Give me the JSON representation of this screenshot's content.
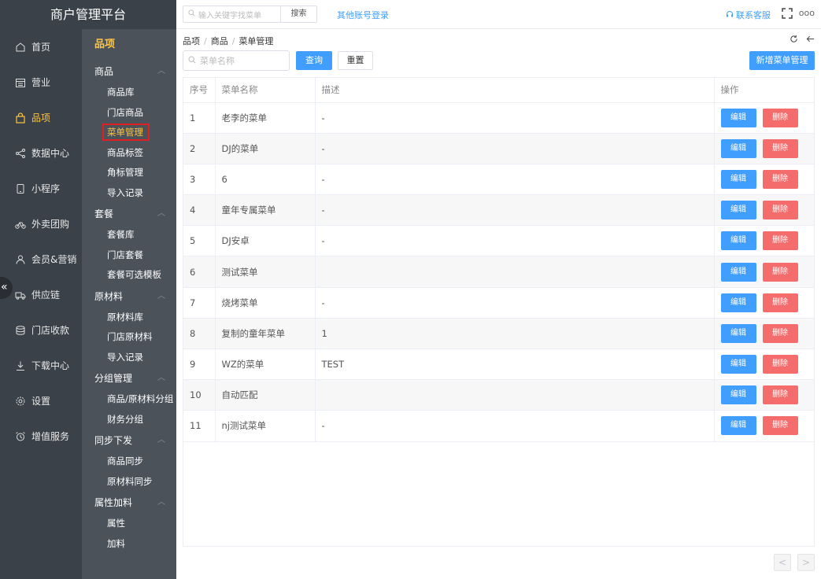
{
  "app": {
    "title": "商户管理平台"
  },
  "topbar": {
    "search_placeholder": "输入关键字找菜单",
    "search_button": "搜索",
    "other_login": "其他账号登录",
    "contact": "联系客服",
    "more": "ooo"
  },
  "nav": {
    "items": [
      {
        "label": "首页",
        "icon": "home-icon",
        "active": false
      },
      {
        "label": "营业",
        "icon": "calendar-icon",
        "active": false
      },
      {
        "label": "品项",
        "icon": "bag-icon",
        "active": true
      },
      {
        "label": "数据中心",
        "icon": "share-icon",
        "active": false
      },
      {
        "label": "小程序",
        "icon": "phone-icon",
        "active": false
      },
      {
        "label": "外卖团购",
        "icon": "bike-icon",
        "active": false
      },
      {
        "label": "会员&营销",
        "icon": "user-icon",
        "active": false
      },
      {
        "label": "供应链",
        "icon": "truck-icon",
        "active": false
      },
      {
        "label": "门店收款",
        "icon": "database-icon",
        "active": false
      },
      {
        "label": "下载中心",
        "icon": "download-icon",
        "active": false
      },
      {
        "label": "设置",
        "icon": "gear-icon",
        "active": false
      },
      {
        "label": "增值服务",
        "icon": "alarm-icon",
        "active": false
      }
    ],
    "collapse": "«"
  },
  "subnav": {
    "title": "品项",
    "groups": [
      {
        "label": "商品",
        "items": [
          "商品库",
          "门店商品",
          "菜单管理",
          "商品标签",
          "角标管理",
          "导入记录"
        ]
      },
      {
        "label": "套餐",
        "items": [
          "套餐库",
          "门店套餐",
          "套餐可选模板"
        ]
      },
      {
        "label": "原材料",
        "items": [
          "原材料库",
          "门店原材料",
          "导入记录"
        ]
      },
      {
        "label": "分组管理",
        "items": [
          "商品/原材料分组",
          "财务分组"
        ]
      },
      {
        "label": "同步下发",
        "items": [
          "商品同步",
          "原材料同步"
        ]
      },
      {
        "label": "属性加料",
        "items": [
          "属性",
          "加料"
        ]
      }
    ]
  },
  "breadcrumb": {
    "a": "品项",
    "b": "商品",
    "c": "菜单管理",
    "sep": "/"
  },
  "filters": {
    "name_placeholder": "菜单名称",
    "query": "查询",
    "reset": "重置",
    "new": "新增菜单管理"
  },
  "table": {
    "headers": [
      "序号",
      "菜单名称",
      "描述",
      "操作"
    ],
    "edit": "编辑",
    "delete": "删除",
    "rows": [
      {
        "no": "1",
        "name": "老李的菜单",
        "desc": "-"
      },
      {
        "no": "2",
        "name": "DJ的菜单",
        "desc": "-"
      },
      {
        "no": "3",
        "name": "6",
        "desc": "-"
      },
      {
        "no": "4",
        "name": "童年专属菜单",
        "desc": "-"
      },
      {
        "no": "5",
        "name": "DJ安卓",
        "desc": "-"
      },
      {
        "no": "6",
        "name": "测试菜单",
        "desc": ""
      },
      {
        "no": "7",
        "name": "烧烤菜单",
        "desc": "-"
      },
      {
        "no": "8",
        "name": "复制的童年菜单",
        "desc": "1"
      },
      {
        "no": "9",
        "name": "WZ的菜单",
        "desc": "TEST"
      },
      {
        "no": "10",
        "name": "自动匹配",
        "desc": ""
      },
      {
        "no": "11",
        "name": "nj测试菜单",
        "desc": "-"
      }
    ]
  },
  "pager": {
    "prev": "<",
    "next": ">"
  },
  "colors": {
    "primary": "#409eff",
    "danger": "#f56c6c",
    "accent": "#ffc53d",
    "nav_bg": "#3b4148",
    "subnav_bg": "#4b525a"
  }
}
